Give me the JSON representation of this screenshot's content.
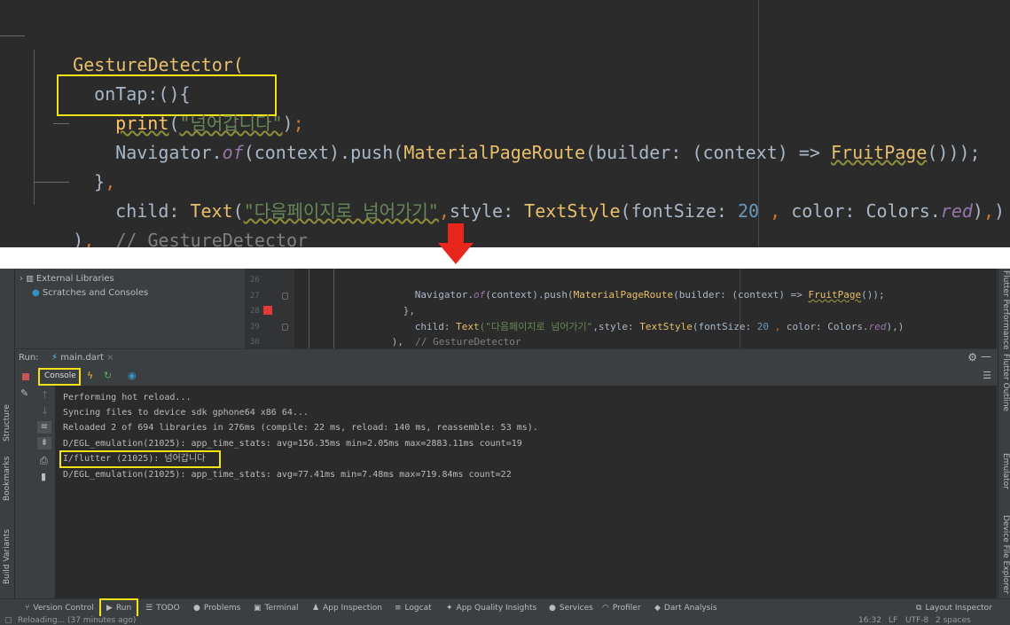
{
  "zoomed_code": {
    "line1": {
      "cls": "GestureDetector",
      "paren": "("
    },
    "line2": {
      "text": "onTap:(){"
    },
    "line3": {
      "fn": "print",
      "open": "(",
      "str": "\"넘어갑니다\"",
      "close": ")",
      "semi": ";"
    },
    "line4": {
      "nav": "Navigator.",
      "of": "of",
      "ctx": "(context).push(",
      "route": "MaterialPageRoute",
      "builder": "(builder: (context) ",
      "arrow": "=>",
      "page": "FruitPage",
      "tail": "()));"
    },
    "line5": {
      "text": "}",
      "comma": ","
    },
    "line6": {
      "child": "child: ",
      "textcls": "Text",
      "open": "(",
      "str": "\"다음페이지로 넘어가기\"",
      "comma": ",",
      "style": "style: ",
      "ts": "TextStyle",
      "fs": "(fontSize: ",
      "num": "20",
      "sp": " , ",
      "color": "color: Colors.",
      "red": "red",
      "end": ")",
      "comma2": ",",
      "close": ")"
    },
    "line7": {
      "paren": ")",
      "comma": ",",
      "comment": "// GestureDetector"
    }
  },
  "project": {
    "items": [
      {
        "label": "External Libraries"
      },
      {
        "label": "Scratches and Consoles"
      }
    ]
  },
  "editor": {
    "line_numbers": [
      "26",
      "27",
      "28",
      "29",
      "30"
    ],
    "l26": {
      "nav": "Navigator.",
      "of": "of",
      "ctx": "(context).push(",
      "route": "MaterialPageRoute",
      "builder": "(builder: (context) ",
      "arrow": "=>",
      "page": "FruitPage",
      "tail": "());"
    },
    "l27": {
      "text": "},"
    },
    "l28": {
      "child": "child: ",
      "textcls": "Text",
      "str": "(\"다음페이지로 넘어가기\"",
      "rest": ",style: ",
      "ts": "TextStyle",
      "fs": "(fontSize: ",
      "num": "20",
      "sp": " , ",
      "color": "color: Colors.",
      "red": "red",
      "end": "),)"
    },
    "l29": {
      "paren": "),",
      "comment": "// GestureDetector"
    }
  },
  "run": {
    "label": "Run:",
    "tab": "main.dart",
    "console_tab": "Console"
  },
  "console_lines": [
    "Performing hot reload...",
    "Syncing files to device sdk gphone64 x86 64...",
    "Reloaded 2 of 694 libraries in 276ms (compile: 22 ms, reload: 140 ms, reassemble: 53 ms).",
    "D/EGL_emulation(21025): app_time_stats: avg=156.35ms min=2.05ms max=2883.11ms count=19",
    "I/flutter (21025): 넘어갑니다",
    "D/EGL_emulation(21025): app_time_stats: avg=77.41ms min=7.48ms max=719.84ms count=22"
  ],
  "left_tabs": [
    "Structure",
    "Bookmarks",
    "Build Variants"
  ],
  "right_tabs": [
    "Flutter Performance",
    "Flutter Outline",
    "Emulator",
    "Device File Explorer"
  ],
  "bottom_tabs": [
    "Version Control",
    "Run",
    "TODO",
    "Problems",
    "Terminal",
    "App Inspection",
    "Logcat",
    "App Quality Insights",
    "Services",
    "Profiler",
    "Dart Analysis"
  ],
  "layout_inspector": "Layout Inspector",
  "status": {
    "left": "Reloading... (37 minutes ago)",
    "time": "16:32",
    "lf": "LF",
    "enc": "UTF-8",
    "indent": "2 spaces"
  },
  "colors": {
    "highlight": "#f2e317",
    "arrow": "#e8261c",
    "breakpoint": "#e53935"
  }
}
